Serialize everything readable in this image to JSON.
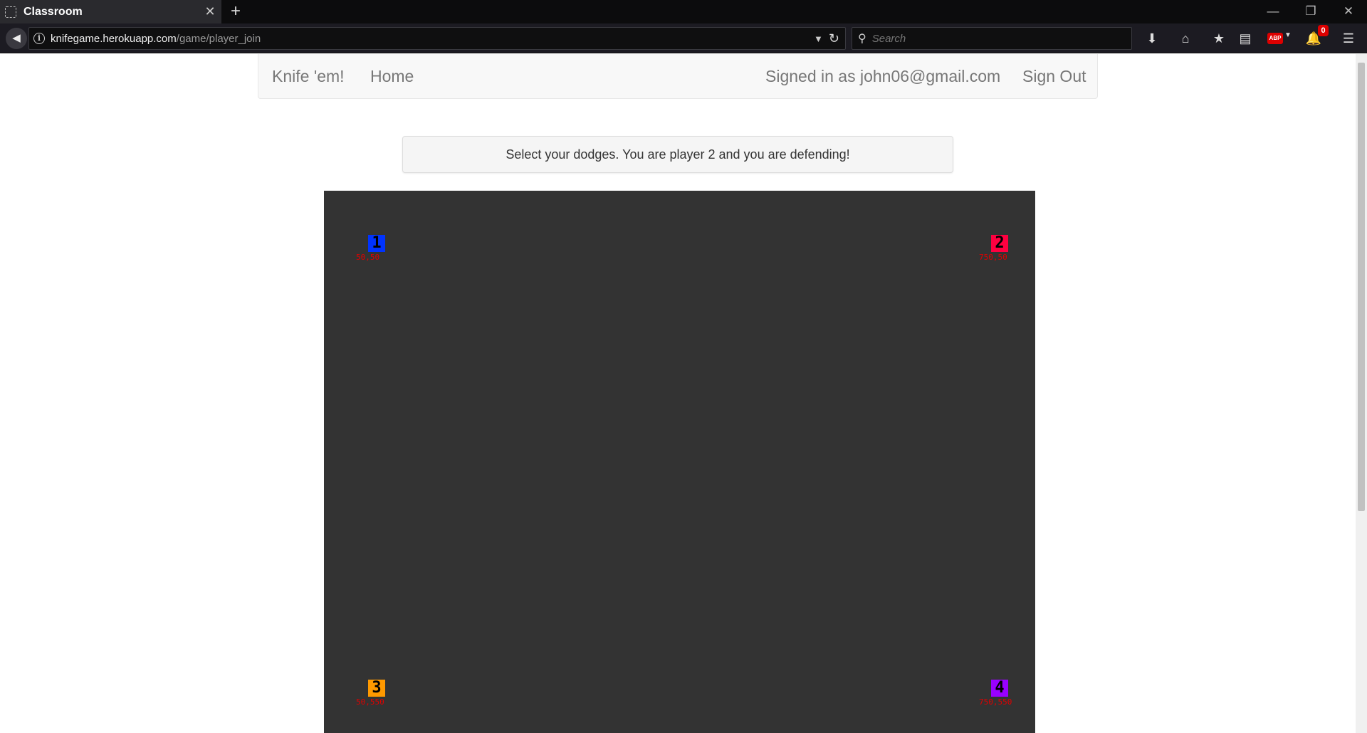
{
  "browser": {
    "tab_title": "Classroom",
    "url_host": "knifegame.herokuapp.com",
    "url_path": "/game/player_join",
    "search_placeholder": "Search",
    "notification_count": "0",
    "abp_label": "ABP"
  },
  "site": {
    "brand": "Knife 'em!",
    "home_link": "Home",
    "signed_in_text": "Signed in as john06@gmail.com",
    "sign_out_link": "Sign Out"
  },
  "game": {
    "instruction": "Select your dodges. You are player 2 and you are defending!",
    "board_color": "#333333",
    "players": [
      {
        "number": "1",
        "coords": "50,50",
        "color": "#0033ff"
      },
      {
        "number": "2",
        "coords": "750,50",
        "color": "#ff0040"
      },
      {
        "number": "3",
        "coords": "50,550",
        "color": "#ff9900"
      },
      {
        "number": "4",
        "coords": "750,550",
        "color": "#9900ff"
      }
    ]
  }
}
